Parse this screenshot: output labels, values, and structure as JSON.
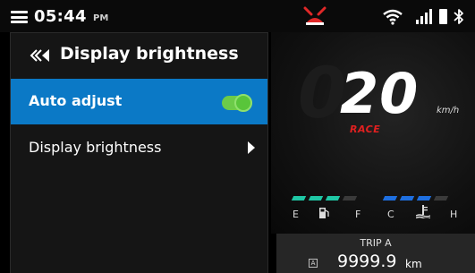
{
  "status_bar": {
    "time": "05:44",
    "ampm": "PM",
    "icons": [
      "menu-icon",
      "bike-alert-icon",
      "wifi-icon",
      "signal-icon",
      "battery-icon",
      "bluetooth-icon"
    ],
    "alert_color": "#e02828"
  },
  "panel": {
    "title": "Display brightness",
    "back_icon": "double-chevron-left-icon",
    "items": [
      {
        "label": "Auto adjust",
        "control": "toggle",
        "toggle_on": true,
        "selected": true
      },
      {
        "label": "Display brightness",
        "control": "chevron-right-icon",
        "selected": false
      }
    ]
  },
  "dashboard": {
    "speed": "20",
    "speed_unit": "km/h",
    "mode": "RACE",
    "fuel": {
      "low_label": "E",
      "high_label": "F",
      "icon": "fuel-pump-icon",
      "level_segments_filled": 3,
      "level_segments_total": 4,
      "color": "#1fc7a5"
    },
    "temp": {
      "low_label": "C",
      "high_label": "H",
      "icon": "coolant-temp-icon",
      "level_segments_filled": 3,
      "level_segments_total": 4,
      "color": "#1e6fe0"
    },
    "trip": {
      "label": "TRIP A",
      "badge": "A",
      "value": "9999.9",
      "unit": "km"
    }
  },
  "colors": {
    "accent": "#0b79c6",
    "toggle_on": "#59c53a",
    "mode": "#e02020"
  }
}
